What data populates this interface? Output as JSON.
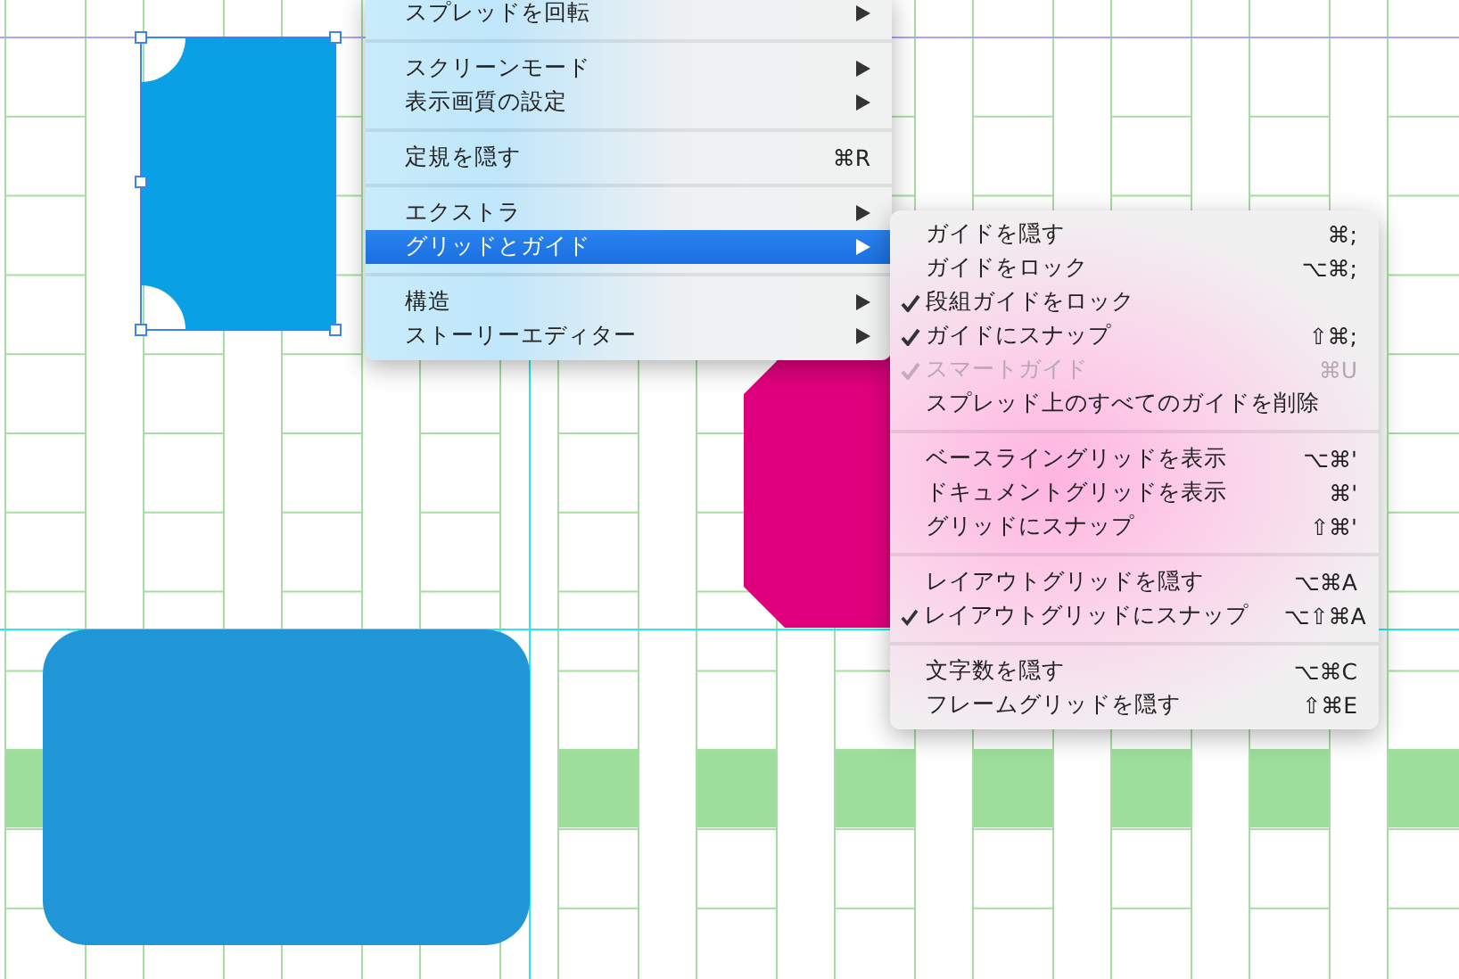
{
  "context_menu": {
    "items": [
      {
        "kind": "item",
        "label": "スプレッドを回転",
        "submenu": true,
        "selected": false
      },
      {
        "kind": "separator"
      },
      {
        "kind": "item",
        "label": "スクリーンモード",
        "submenu": true,
        "selected": false
      },
      {
        "kind": "item",
        "label": "表示画質の設定",
        "submenu": true,
        "selected": false
      },
      {
        "kind": "separator"
      },
      {
        "kind": "item",
        "label": "定規を隠す",
        "shortcut": "⌘R",
        "submenu": false,
        "selected": false
      },
      {
        "kind": "separator"
      },
      {
        "kind": "item",
        "label": "エクストラ",
        "submenu": true,
        "selected": false
      },
      {
        "kind": "item",
        "label": "グリッドとガイド",
        "submenu": true,
        "selected": true
      },
      {
        "kind": "separator"
      },
      {
        "kind": "item",
        "label": "構造",
        "submenu": true,
        "selected": false
      },
      {
        "kind": "item",
        "label": "ストーリーエディター",
        "submenu": true,
        "selected": false
      }
    ]
  },
  "submenu": {
    "items": [
      {
        "kind": "item",
        "label": "ガイドを隠す",
        "shortcut": "⌘;",
        "checked": false,
        "disabled": false
      },
      {
        "kind": "item",
        "label": "ガイドをロック",
        "shortcut": "⌥⌘;",
        "checked": false,
        "disabled": false
      },
      {
        "kind": "item",
        "label": "段組ガイドをロック",
        "checked": true,
        "disabled": false
      },
      {
        "kind": "item",
        "label": "ガイドにスナップ",
        "shortcut": "⇧⌘;",
        "checked": true,
        "disabled": false
      },
      {
        "kind": "item",
        "label": "スマートガイド",
        "shortcut": "⌘U",
        "checked": true,
        "disabled": true
      },
      {
        "kind": "item",
        "label": "スプレッド上のすべてのガイドを削除",
        "checked": false,
        "disabled": false
      },
      {
        "kind": "separator"
      },
      {
        "kind": "item",
        "label": "ベースライングリッドを表示",
        "shortcut": "⌥⌘'",
        "checked": false,
        "disabled": false
      },
      {
        "kind": "item",
        "label": "ドキュメントグリッドを表示",
        "shortcut": "⌘'",
        "checked": false,
        "disabled": false
      },
      {
        "kind": "item",
        "label": "グリッドにスナップ",
        "shortcut": "⇧⌘'",
        "checked": false,
        "disabled": false
      },
      {
        "kind": "separator"
      },
      {
        "kind": "item",
        "label": "レイアウトグリッドを隠す",
        "shortcut": "⌥⌘A",
        "checked": false,
        "disabled": false
      },
      {
        "kind": "item",
        "label": "レイアウトグリッドにスナップ",
        "shortcut": "⌥⇧⌘A",
        "checked": true,
        "disabled": false
      },
      {
        "kind": "separator"
      },
      {
        "kind": "item",
        "label": "文字数を隠す",
        "shortcut": "⌥⌘C",
        "checked": false,
        "disabled": false
      },
      {
        "kind": "item",
        "label": "フレームグリッドを隠す",
        "shortcut": "⇧⌘E",
        "checked": false,
        "disabled": false
      }
    ]
  }
}
